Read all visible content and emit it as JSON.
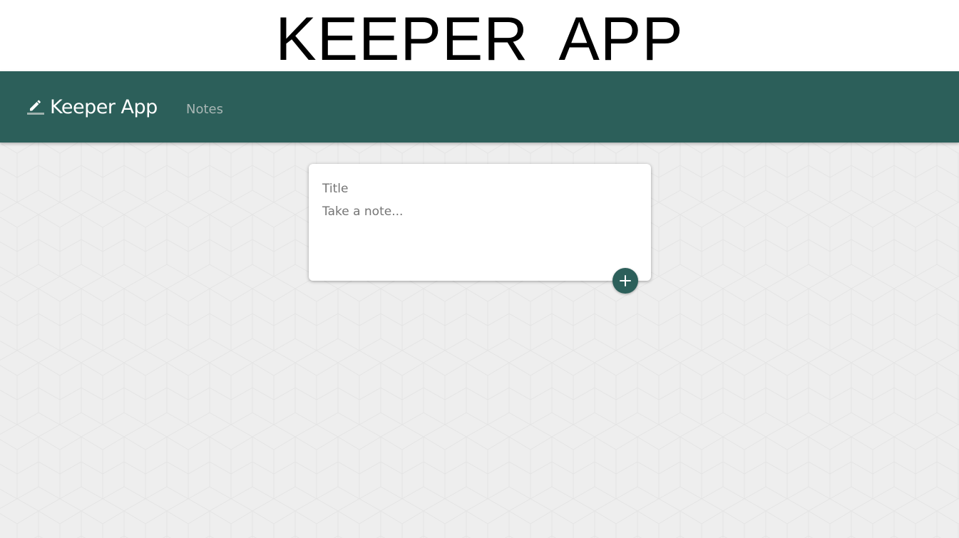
{
  "page_heading": "KEEPER  APP",
  "navbar": {
    "brand_icon": "pencil-icon",
    "brand_label": "Keeper App",
    "nav_link_label": "Notes",
    "background_color": "#2c5f5a"
  },
  "note_form": {
    "title_placeholder": "Title",
    "content_placeholder": "Take a note...",
    "add_button_icon": "plus-icon"
  },
  "colors": {
    "accent": "#2c5f5a",
    "page_background": "#eeeeee"
  }
}
